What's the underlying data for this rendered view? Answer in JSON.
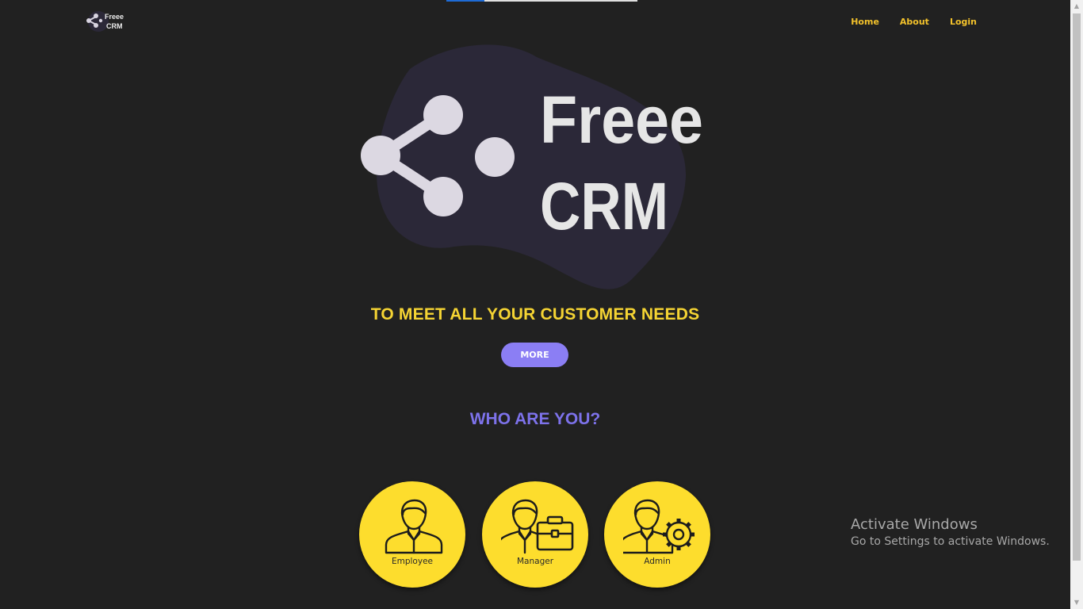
{
  "nav": {
    "items": [
      "Home",
      "About",
      "Login"
    ]
  },
  "logo": {
    "line1": "Freee",
    "line2": "CRM"
  },
  "hero": {
    "line1": "Freee",
    "line2": "CRM"
  },
  "tagline": "TO MEET ALL YOUR CUSTOMER NEEDS",
  "more_button": "MORE",
  "who_heading": "WHO ARE YOU?",
  "roles": [
    "Employee",
    "Manager",
    "Admin"
  ],
  "watermark": {
    "title": "Activate Windows",
    "subtitle": "Go to Settings to activate Windows."
  },
  "colors": {
    "background": "#212121",
    "accent_yellow": "#fddd2d",
    "accent_purple": "#8b7ef4",
    "nav_text": "#f3c22b"
  }
}
